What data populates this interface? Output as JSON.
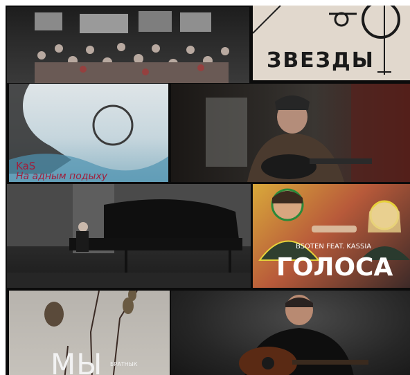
{
  "tiles": {
    "zvezdy": {
      "title": "ЗВЕЗДЫ"
    },
    "kas": {
      "artist": "KaS",
      "song": "На адным подыху"
    },
    "golosa": {
      "artists": "BSOTEN FEAT. KASSIA",
      "title": "ГОЛОСА"
    },
    "my": {
      "title": "МЫ",
      "subtitle": "БРАТНЫК"
    }
  },
  "colors": {
    "gallery_bg": "#0b0b0b",
    "zvezdy_bg": "#e1d8cd",
    "kas_text": "#a01f3c",
    "golosa_text": "#ffffff"
  }
}
